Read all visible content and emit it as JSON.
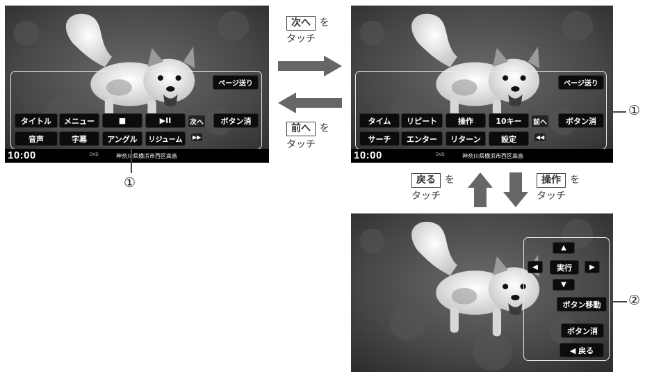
{
  "clock": "10:00",
  "source_label": "DVD",
  "location": "神奈川県横浜市西区高島",
  "screen1": {
    "page_button": "ページ送り",
    "hide_button": "ボタン消",
    "next_button": "次へ",
    "ff_icon": "▶▶",
    "row1": [
      "タイトル",
      "メニュー",
      "■",
      "▶II"
    ],
    "row2": [
      "音声",
      "字幕",
      "アングル",
      "リジューム"
    ]
  },
  "screen2": {
    "page_button": "ページ送り",
    "hide_button": "ボタン消",
    "prev_button": "前へ",
    "rew_icon": "◀◀",
    "row1": [
      "タイム",
      "リピート",
      "操作",
      "10キー"
    ],
    "row2": [
      "サーチ",
      "エンター",
      "リターン",
      "設定"
    ]
  },
  "screen3": {
    "up": "▲",
    "left": "◀",
    "exec": "実行",
    "right": "▶",
    "down": "▼",
    "move": "ボタン移動",
    "hide": "ボタン消",
    "back": "◀ 戻る"
  },
  "instructions": {
    "next_key": "次へ",
    "prev_key": "前へ",
    "back_key": "戻る",
    "op_key": "操作",
    "suffix": "を",
    "touch": "タッチ"
  },
  "callouts": {
    "one": "①",
    "two": "②"
  },
  "colors": {
    "bar": "#000000",
    "button": "#0c0c0c",
    "arrow": "#666666",
    "frame": "#e8e8e8"
  }
}
